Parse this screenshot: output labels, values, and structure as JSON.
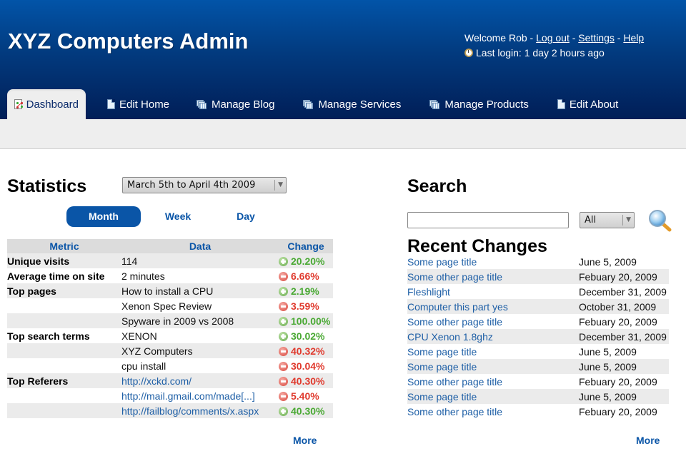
{
  "header": {
    "app_title": "XYZ Computers Admin",
    "welcome_text": "Welcome Rob",
    "separator": " - ",
    "links": {
      "logout": "Log out",
      "settings": "Settings",
      "help": "Help"
    },
    "last_login": "Last login: 1 day 2 hours ago",
    "clock_icon": "clock-icon"
  },
  "tabs": [
    {
      "label": "Dashboard",
      "icon": "dashboard-chart-icon",
      "active": true
    },
    {
      "label": "Edit Home",
      "icon": "document-icon",
      "active": false
    },
    {
      "label": "Manage Blog",
      "icon": "stacked-windows-icon",
      "active": false
    },
    {
      "label": "Manage Services",
      "icon": "stacked-windows-icon",
      "active": false
    },
    {
      "label": "Manage Products",
      "icon": "stacked-windows-icon",
      "active": false
    },
    {
      "label": "Edit About",
      "icon": "document-icon",
      "active": false
    }
  ],
  "statistics": {
    "title": "Statistics",
    "date_range": "March 5th to April 4th 2009",
    "periods": [
      {
        "label": "Month",
        "active": true
      },
      {
        "label": "Week",
        "active": false
      },
      {
        "label": "Day",
        "active": false
      }
    ],
    "columns": [
      "Metric",
      "Data",
      "Change"
    ],
    "rows": [
      {
        "metric": "Unique visits",
        "data": "114",
        "link": false,
        "change": "20.20%",
        "direction": "up"
      },
      {
        "metric": "Average time on site",
        "data": "2 minutes",
        "link": false,
        "change": "6.66%",
        "direction": "down"
      },
      {
        "metric": "Top pages",
        "data": "How to install a CPU",
        "link": false,
        "change": "2.19%",
        "direction": "up"
      },
      {
        "metric": "",
        "data": "Xenon Spec Review",
        "link": false,
        "change": "3.59%",
        "direction": "down"
      },
      {
        "metric": "",
        "data": "Spyware in 2009 vs 2008",
        "link": false,
        "change": "100.00%",
        "direction": "up"
      },
      {
        "metric": "Top search terms",
        "data": "XENON",
        "link": false,
        "change": "30.02%",
        "direction": "up"
      },
      {
        "metric": "",
        "data": "XYZ Computers",
        "link": false,
        "change": "40.32%",
        "direction": "down"
      },
      {
        "metric": "",
        "data": "cpu install",
        "link": false,
        "change": "30.04%",
        "direction": "down"
      },
      {
        "metric": "Top Referers",
        "data": "http://xckd.com/",
        "link": true,
        "change": "40.30%",
        "direction": "down"
      },
      {
        "metric": "",
        "data": "http://mail.gmail.com/made[...]",
        "link": true,
        "change": "5.40%",
        "direction": "down"
      },
      {
        "metric": "",
        "data": "http://failblog/comments/x.aspx",
        "link": true,
        "change": "40.30%",
        "direction": "up"
      }
    ],
    "more_label": "More"
  },
  "search": {
    "title": "Search",
    "input_value": "",
    "input_placeholder": "",
    "scope_selected": "All",
    "search_icon": "magnifier-icon"
  },
  "recent_changes": {
    "title": "Recent Changes",
    "items": [
      {
        "title": "Some page title",
        "date": "June 5, 2009"
      },
      {
        "title": "Some other page title",
        "date": "Febuary 20, 2009"
      },
      {
        "title": "Fleshlight",
        "date": "December 31, 2009"
      },
      {
        "title": "Computer this part yes",
        "date": "October 31, 2009"
      },
      {
        "title": "Some other page title",
        "date": "Febuary 20, 2009"
      },
      {
        "title": "CPU Xenon 1.8ghz",
        "date": "December 31, 2009"
      },
      {
        "title": "Some page title",
        "date": "June 5, 2009"
      },
      {
        "title": "Some page title",
        "date": "June 5, 2009"
      },
      {
        "title": "Some other page title",
        "date": "Febuary 20, 2009"
      },
      {
        "title": "Some page title",
        "date": "June 5, 2009"
      },
      {
        "title": "Some other page title",
        "date": "Febuary 20, 2009"
      }
    ],
    "more_label": "More"
  },
  "colors": {
    "header_top": "#0254a8",
    "header_bottom": "#011e57",
    "accent_blue": "#0a55a7",
    "link_blue": "#1e5fa6",
    "change_up": "#4aa934",
    "change_down": "#e03a2e",
    "row_stripe": "#ebebeb"
  }
}
